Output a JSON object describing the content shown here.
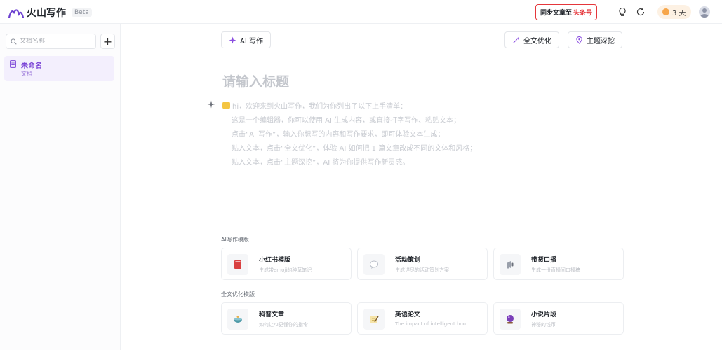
{
  "header": {
    "app_name": "火山写作",
    "beta_label": "Beta",
    "sync_label": "同步文章至",
    "sync_brand": "头条号",
    "streak_label": "3 天"
  },
  "sidebar": {
    "search_placeholder": "文档名称",
    "add_label": "+",
    "documents": [
      {
        "title": "未命名",
        "subtitle": "文档"
      }
    ]
  },
  "toolbar": {
    "ai_write_label": "AI 写作",
    "full_optimize_label": "全文优化",
    "topic_deep_label": "主题深挖"
  },
  "editor": {
    "title_placeholder": "请输入标题",
    "hint_lines": [
      "hi，欢迎来到火山写作，我们为你列出了以下上手清单：",
      "这是一个编辑器，你可以使用 AI 生成内容，或直接打字写作、粘贴文本；",
      "点击“AI 写作”，输入你想写的内容和写作要求，即可体验文本生成；",
      "贴入文本，点击“全文优化”，体验 AI 如何把 1 篇文章改成不同的文体和风格；",
      "贴入文本，点击“主题深挖”，AI 将为你提供写作新灵感。"
    ]
  },
  "templates": {
    "ai_section_label": "AI写作模版",
    "ai_cards": [
      {
        "title": "小红书模版",
        "desc": "生成带emoji的种草笔记",
        "icon": "book-icon"
      },
      {
        "title": "活动策划",
        "desc": "生成详尽的活动策划方案",
        "icon": "chat-bubble-icon"
      },
      {
        "title": "带货口播",
        "desc": "生成一份直播间口播稿",
        "icon": "megaphone-icon"
      }
    ],
    "optimize_section_label": "全文优化模版",
    "optimize_cards": [
      {
        "title": "科普文章",
        "desc": "如何让AI更懂你的指令",
        "icon": "bowl-icon"
      },
      {
        "title": "英语论文",
        "desc": "The impact of intelligent hou...",
        "icon": "notepad-icon"
      },
      {
        "title": "小说片段",
        "desc": "神秘的钱币",
        "icon": "crystal-ball-icon"
      }
    ]
  },
  "colors": {
    "accent": "#7b45d6",
    "brand_red": "#e5363b"
  }
}
